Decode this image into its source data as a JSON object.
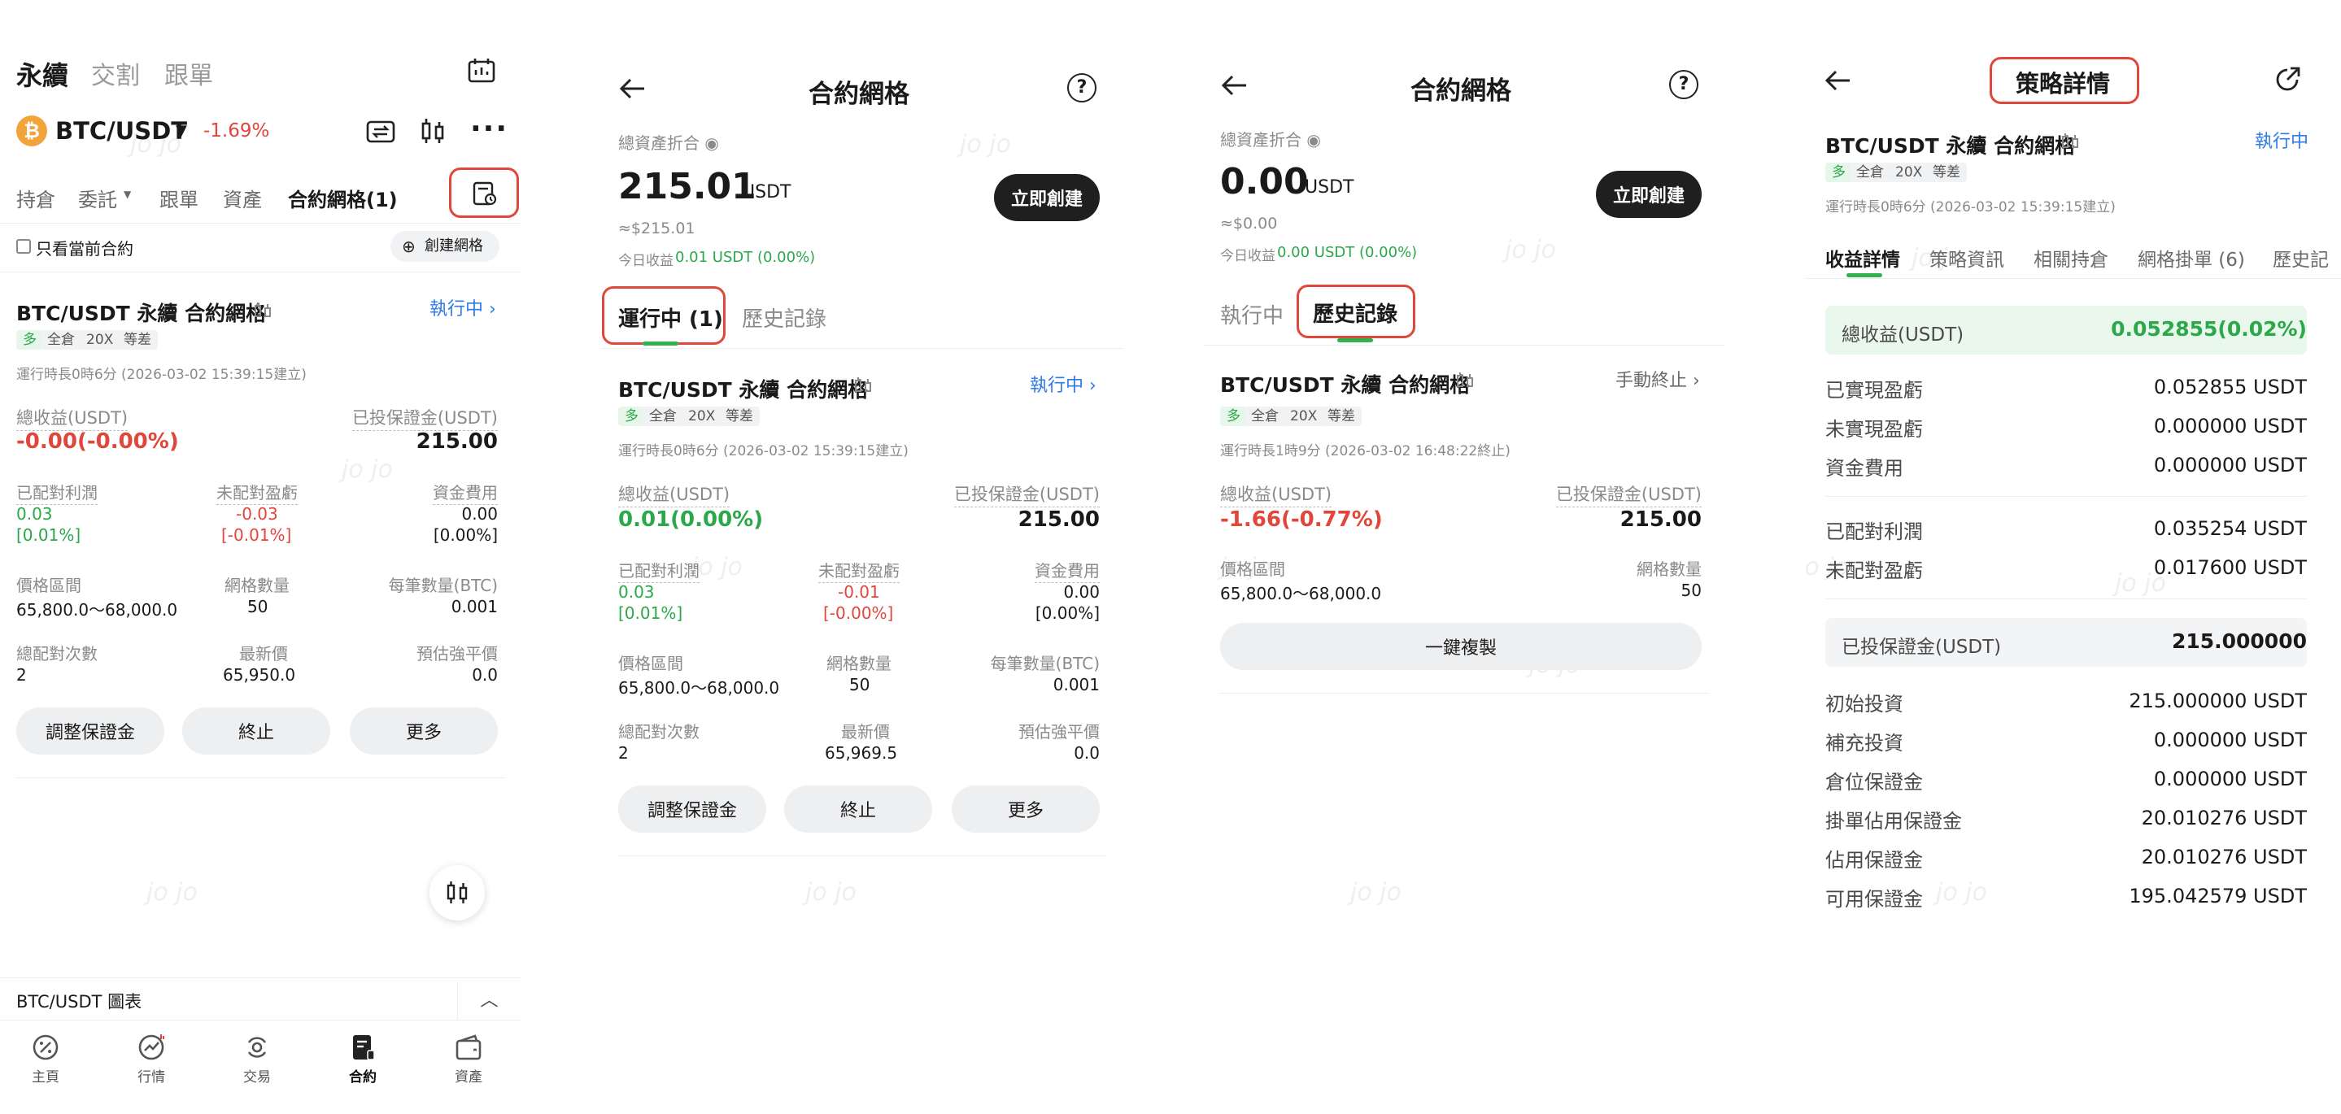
{
  "watermark": "jo jo",
  "p1": {
    "top_tabs": [
      "永續",
      "交割",
      "跟單"
    ],
    "pair": "BTC/USDT",
    "change": "-1.69%",
    "sub_tabs": [
      "持倉",
      "委託",
      "跟單",
      "資產",
      "合約網格(1)"
    ],
    "only_current": "只看當前合約",
    "create_grid": "創建網格",
    "card": {
      "title": "BTC/USDT 永續 合約網格",
      "status": "執行中",
      "tags": [
        "多",
        "全倉",
        "20X",
        "等差"
      ],
      "runtime": "運行時長0時6分 (2026-03-02 15:39:15建立)",
      "total_profit_label": "總收益(USDT)",
      "total_profit": "-0.00(-0.00%)",
      "invested_label": "已投保證金(USDT)",
      "invested": "215.00",
      "matched_label": "已配對利潤",
      "matched_val": "0.03",
      "matched_pct": "[0.01%]",
      "unmatched_label": "未配對盈虧",
      "unmatched_val": "-0.03",
      "unmatched_pct": "[-0.01%]",
      "funding_label": "資金費用",
      "funding_val": "0.00",
      "funding_pct": "[0.00%]",
      "range_label": "價格區間",
      "range": "65,800.0～68,000.0",
      "grids_label": "網格數量",
      "grids": "50",
      "per_label": "每筆數量(BTC)",
      "per": "0.001",
      "pairs_label": "總配對次數",
      "pairs": "2",
      "last_label": "最新價",
      "last": "65,950.0",
      "liq_label": "預估強平價",
      "liq": "0.0",
      "buttons": [
        "調整保證金",
        "終止",
        "更多"
      ]
    },
    "chart_bar": "BTC/USDT 圖表",
    "nav": [
      "主頁",
      "行情",
      "交易",
      "合約",
      "資產"
    ]
  },
  "p2": {
    "title": "合約網格",
    "assets_label": "總資產折合",
    "assets": "215.01",
    "unit": "USDT",
    "approx": "≈$215.01",
    "today_label": "今日收益",
    "today": "0.01 USDT (0.00%)",
    "create": "立即創建",
    "tabs": [
      "運行中 (1)",
      "歷史記錄"
    ],
    "card": {
      "title": "BTC/USDT 永續 合約網格",
      "status": "執行中",
      "tags": [
        "多",
        "全倉",
        "20X",
        "等差"
      ],
      "runtime": "運行時長0時6分 (2026-03-02 15:39:15建立)",
      "total_profit_label": "總收益(USDT)",
      "total_profit": "0.01(0.00%)",
      "invested_label": "已投保證金(USDT)",
      "invested": "215.00",
      "matched_label": "已配對利潤",
      "matched_val": "0.03",
      "matched_pct": "[0.01%]",
      "unmatched_label": "未配對盈虧",
      "unmatched_val": "-0.01",
      "unmatched_pct": "[-0.00%]",
      "funding_label": "資金費用",
      "funding_val": "0.00",
      "funding_pct": "[0.00%]",
      "range_label": "價格區間",
      "range": "65,800.0～68,000.0",
      "grids_label": "網格數量",
      "grids": "50",
      "per_label": "每筆數量(BTC)",
      "per": "0.001",
      "pairs_label": "總配對次數",
      "pairs": "2",
      "last_label": "最新價",
      "last": "65,969.5",
      "liq_label": "預估強平價",
      "liq": "0.0",
      "buttons": [
        "調整保證金",
        "終止",
        "更多"
      ]
    }
  },
  "p3": {
    "title": "合約網格",
    "assets_label": "總資產折合",
    "assets": "0.00",
    "unit": "USDT",
    "approx": "≈$0.00",
    "today_label": "今日收益",
    "today": "0.00 USDT (0.00%)",
    "create": "立即創建",
    "tabs": [
      "執行中",
      "歷史記錄"
    ],
    "card": {
      "title": "BTC/USDT 永續 合約網格",
      "status": "手動終止",
      "tags": [
        "多",
        "全倉",
        "20X",
        "等差"
      ],
      "runtime": "運行時長1時9分 (2026-03-02 16:48:22終止)",
      "total_profit_label": "總收益(USDT)",
      "total_profit": "-1.66(-0.77%)",
      "invested_label": "已投保證金(USDT)",
      "invested": "215.00",
      "range_label": "價格區間",
      "range": "65,800.0～68,000.0",
      "grids_label": "網格數量",
      "grids": "50",
      "copy": "一鍵複製"
    }
  },
  "p4": {
    "title": "策略詳情",
    "pair_title": "BTC/USDT 永續 合約網格",
    "status": "執行中",
    "tags": [
      "多",
      "全倉",
      "20X",
      "等差"
    ],
    "runtime": "運行時長0時6分 (2026-03-02 15:39:15建立)",
    "tabs": [
      "收益詳情",
      "策略資訊",
      "相關持倉",
      "網格掛單 (6)",
      "歷史記"
    ],
    "total_label": "總收益(USDT)",
    "total": "0.052855(0.02%)",
    "rows1": [
      {
        "label": "已實現盈虧",
        "value": "0.052855 USDT"
      },
      {
        "label": "未實現盈虧",
        "value": "0.000000 USDT"
      },
      {
        "label": "資金費用",
        "value": "0.000000 USDT"
      }
    ],
    "rows2": [
      {
        "label": "已配對利潤",
        "value": "0.035254 USDT"
      },
      {
        "label": "未配對盈虧",
        "value": "0.017600 USDT"
      }
    ],
    "margin_label": "已投保證金(USDT)",
    "margin": "215.000000",
    "rows3": [
      {
        "label": "初始投資",
        "value": "215.000000 USDT"
      },
      {
        "label": "補充投資",
        "value": "0.000000 USDT"
      },
      {
        "label": "倉位保證金",
        "value": "0.000000 USDT"
      },
      {
        "label": "掛單佔用保證金",
        "value": "20.010276 USDT"
      },
      {
        "label": "佔用保證金",
        "value": "20.010276 USDT"
      },
      {
        "label": "可用保證金",
        "value": "195.042579 USDT"
      }
    ]
  }
}
